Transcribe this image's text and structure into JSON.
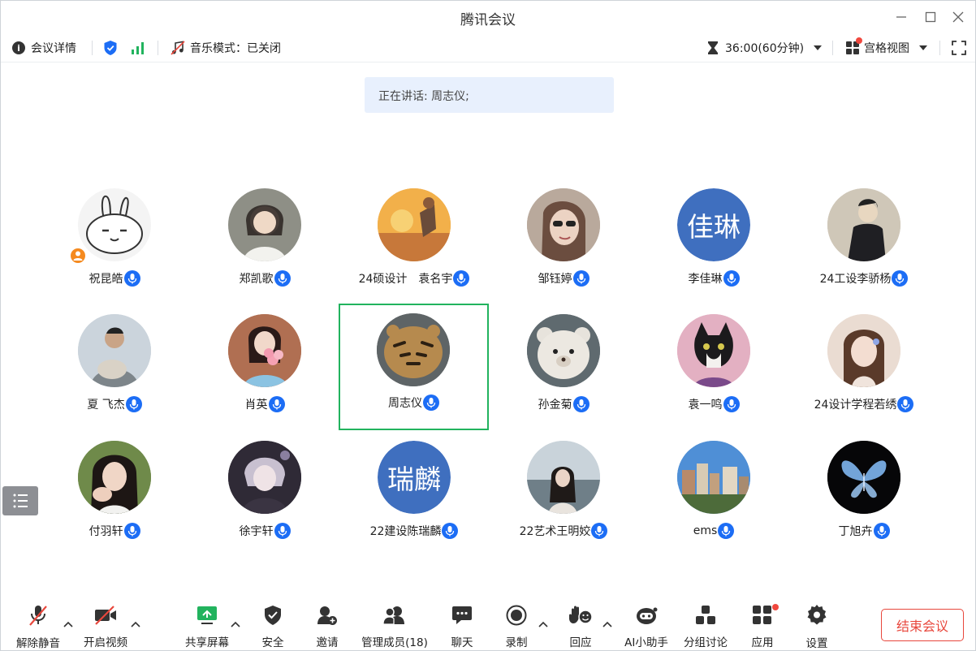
{
  "window": {
    "title": "腾讯会议"
  },
  "infobar": {
    "details_label": "会议详情",
    "music_mode_label": "音乐模式：已关闭",
    "timer_label": "36:00(60分钟)",
    "view_label": "宫格视图"
  },
  "speaker": {
    "text": "正在讲话: 周志仪;"
  },
  "participants": [
    {
      "name": "祝昆皓",
      "avatar": "rabbit-sketch",
      "host": true
    },
    {
      "name": "郑凯歌",
      "avatar": "photo-portrait"
    },
    {
      "name": "24硕设计　袁名宇",
      "avatar": "illustration-sunset"
    },
    {
      "name": "邹钰婷",
      "avatar": "photo-sunglasses"
    },
    {
      "name": "李佳琳",
      "avatar": "text",
      "avatar_text": "佳琳"
    },
    {
      "name": "24工设李骄杨",
      "avatar": "illustration-character"
    },
    {
      "name": "夏 飞杰",
      "avatar": "photo-cat-hug"
    },
    {
      "name": "肖英",
      "avatar": "photo-flowers"
    },
    {
      "name": "周志仪",
      "avatar": "photo-tiger-toy",
      "speaking": true
    },
    {
      "name": "孙金菊",
      "avatar": "photo-teddy-bear"
    },
    {
      "name": "袁一鸣",
      "avatar": "photo-cat"
    },
    {
      "name": "24设计学程若绣",
      "avatar": "photo-girl"
    },
    {
      "name": "付羽轩",
      "avatar": "photo-girl-hand"
    },
    {
      "name": "徐宇轩",
      "avatar": "illustration-anime"
    },
    {
      "name": "22建设陈瑞麟",
      "avatar": "text",
      "avatar_text": "瑞麟"
    },
    {
      "name": "22艺术王明姣",
      "avatar": "photo-sea"
    },
    {
      "name": "ems",
      "avatar": "photo-buildings"
    },
    {
      "name": "丁旭卉",
      "avatar": "illustration-butterfly"
    }
  ],
  "toolbar": {
    "unmute": "解除静音",
    "video": "开启视频",
    "share": "共享屏幕",
    "security": "安全",
    "invite": "邀请",
    "members": "管理成员(18)",
    "chat": "聊天",
    "record": "录制",
    "reaction": "回应",
    "ai": "AI小助手",
    "breakout": "分组讨论",
    "apps": "应用",
    "settings": "设置",
    "end": "结束会议"
  },
  "colors": {
    "accent": "#1c6df5",
    "speaking_border": "#22b35e",
    "end_red": "#e8473c",
    "signal_green": "#22b35e"
  }
}
